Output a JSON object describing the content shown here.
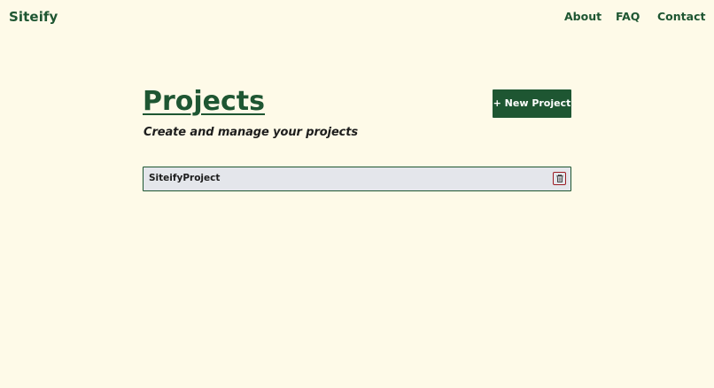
{
  "header": {
    "brand": "Siteify",
    "nav": {
      "about": "About",
      "faq": "FAQ",
      "contact": "Contact"
    }
  },
  "main": {
    "title": "Projects",
    "subtitle": "Create and manage your projects",
    "new_project_label": "+ New Project",
    "projects": [
      {
        "name": "SiteifyProject",
        "action_icon": "trash-icon"
      }
    ]
  },
  "colors": {
    "background": "#fefae8",
    "primary": "#1e5632",
    "row_background": "#e4e6eb",
    "delete": "#9c1c24"
  }
}
